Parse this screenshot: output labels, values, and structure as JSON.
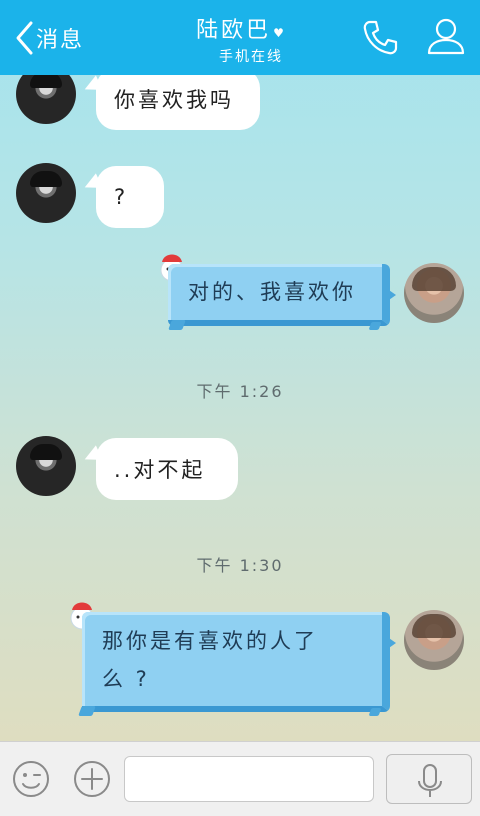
{
  "header": {
    "back_label": "消息",
    "contact_name": "陆欧巴",
    "heart": "♥",
    "status": "手机在线",
    "phone_icon": "phone-icon",
    "profile_icon": "profile-icon"
  },
  "messages": [
    {
      "side": "in",
      "text": "你喜欢我吗"
    },
    {
      "side": "in",
      "text": "?"
    },
    {
      "side": "out",
      "text": "对的、我喜欢你"
    },
    {
      "side": "time",
      "text": "下午 1:26"
    },
    {
      "side": "in",
      "text": "..对不起"
    },
    {
      "side": "time",
      "text": "下午 1:30"
    },
    {
      "side": "out",
      "text_line1": "那你是有喜欢的人了",
      "text_line2": "么 ?"
    }
  ],
  "input": {
    "emoji_icon": "emoji-icon",
    "plus_icon": "plus-icon",
    "mic_icon": "microphone-icon",
    "value": ""
  },
  "colors": {
    "header_bg": "#1bb3ea",
    "bubble_out": "#8fd0f2",
    "bubble_in": "#ffffff"
  }
}
